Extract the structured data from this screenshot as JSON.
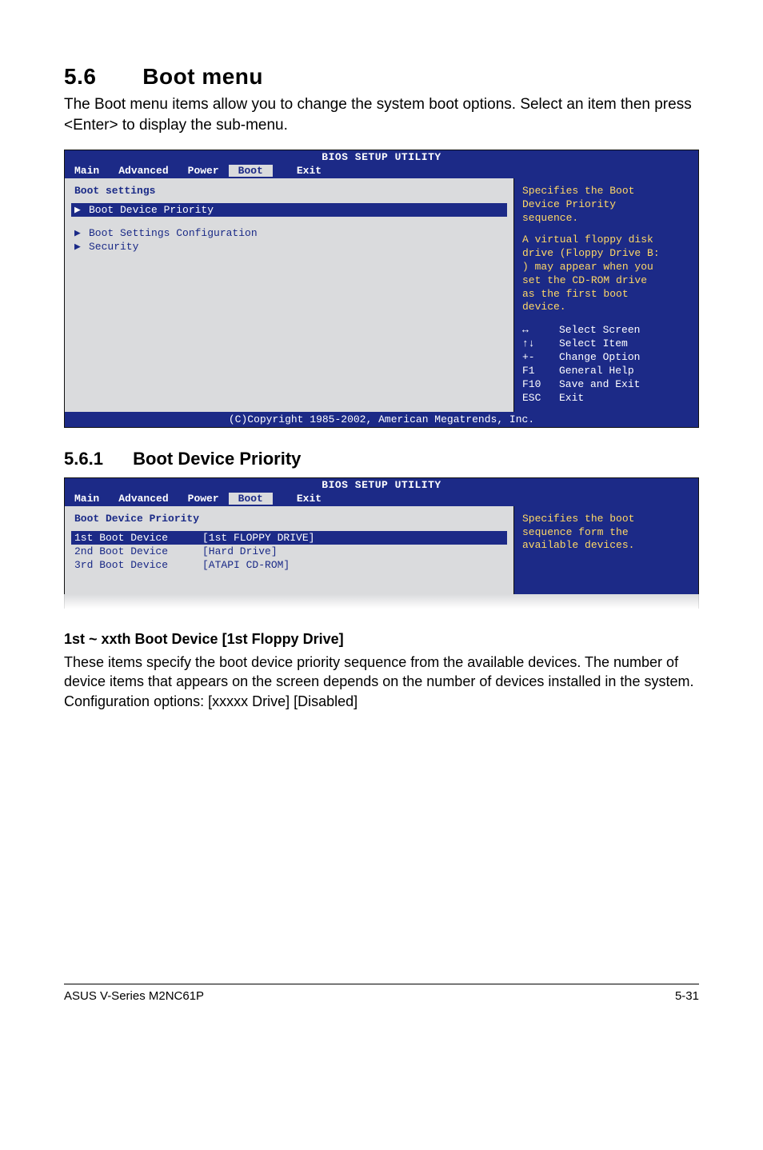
{
  "section": {
    "number": "5.6",
    "title": "Boot menu",
    "intro": "The Boot menu items allow you to change the system boot options. Select an item then press <Enter> to display the sub-menu."
  },
  "bios1": {
    "title": "BIOS SETUP UTILITY",
    "tabs": {
      "main": "Main",
      "advanced": "Advanced",
      "power": "Power",
      "boot": "Boot",
      "exit": "Exit"
    },
    "left_title": "Boot settings",
    "items": {
      "priority": "Boot Device Priority",
      "settings": "Boot Settings Configuration",
      "security": "Security"
    },
    "help": {
      "l1": "Specifies the Boot",
      "l2": "Device Priority",
      "l3": "sequence.",
      "l4": "A virtual floppy disk",
      "l5": "drive (Floppy Drive B:",
      "l6": ") may appear when you",
      "l7": "set the CD-ROM drive",
      "l8": "as the first boot",
      "l9": "device."
    },
    "keys": {
      "select_screen": "Select Screen",
      "select_item": "Select Item",
      "change_option": "Change Option",
      "general_help": "General Help",
      "save_exit": "Save and Exit",
      "exit": "Exit",
      "k1": "↔",
      "k2": "↑↓",
      "k3": "+-",
      "k4": "F1",
      "k5": "F10",
      "k6": "ESC"
    },
    "copyright": "(C)Copyright 1985-2002, American Megatrends, Inc."
  },
  "subsection": {
    "number": "5.6.1",
    "title": "Boot Device Priority"
  },
  "bios2": {
    "title": "BIOS SETUP UTILITY",
    "tabs": {
      "main": "Main",
      "advanced": "Advanced",
      "power": "Power",
      "boot": "Boot",
      "exit": "Exit"
    },
    "left_title": "Boot Device Priority",
    "rows": {
      "r1l": "1st Boot Device",
      "r1r": "[1st FLOPPY DRIVE]",
      "r2l": "2nd Boot Device",
      "r2r": "[Hard Drive]",
      "r3l": "3rd Boot Device",
      "r3r": "[ATAPI CD-ROM]"
    },
    "help": {
      "l1": "Specifies the boot",
      "l2": "sequence form the",
      "l3": "available devices."
    }
  },
  "option": {
    "title": "1st ~ xxth Boot Device [1st Floppy Drive]",
    "body": "These items specify the boot device priority sequence from the available devices. The number of device items that appears on the screen depends on the number of devices installed in the system. Configuration options: [xxxxx Drive] [Disabled]"
  },
  "footer": {
    "left": "ASUS V-Series M2NC61P",
    "right": "5-31"
  }
}
